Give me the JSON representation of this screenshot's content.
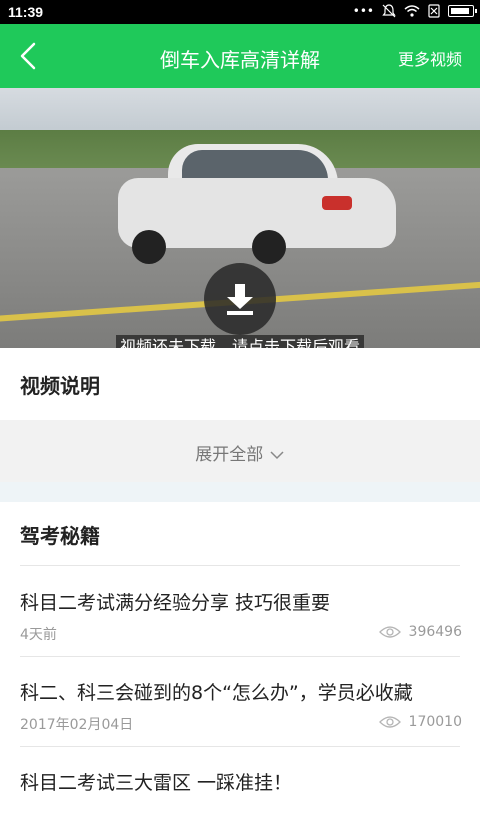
{
  "status_bar": {
    "time": "11:39"
  },
  "nav": {
    "title": "倒车入库高清详解",
    "more_label": "更多视频"
  },
  "video": {
    "tip": "视频还未下载，请点击下载后观看"
  },
  "description": {
    "title": "视频说明",
    "expand_label": "展开全部"
  },
  "tips": {
    "title": "驾考秘籍",
    "items": [
      {
        "title": "科目二考试满分经验分享 技巧很重要",
        "date": "4天前",
        "views": "396496"
      },
      {
        "title": "科二、科三会碰到的8个“怎么办”，学员必收藏",
        "date": "2017年02月04日",
        "views": "170010"
      },
      {
        "title": "科目二考试三大雷区 一踩准挂！",
        "date": "",
        "views": ""
      }
    ]
  },
  "colors": {
    "brand_green": "#1fc95a"
  }
}
